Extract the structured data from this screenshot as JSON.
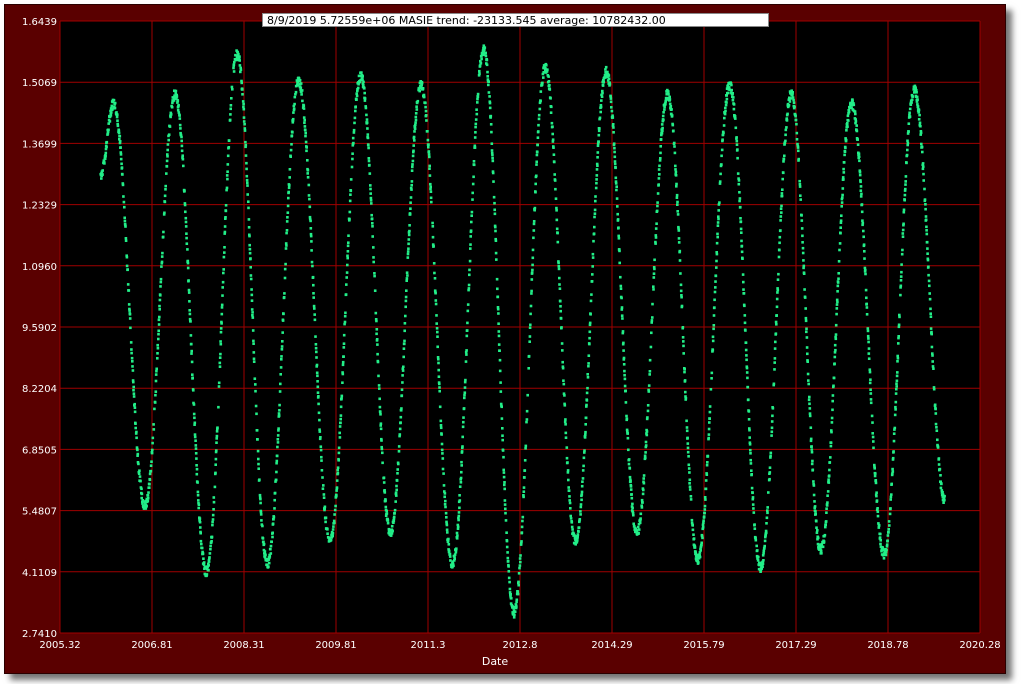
{
  "chart_data": {
    "type": "scatter",
    "title": "8/9/2019 5.72559e+06   MASIE trend: -23133.545 average: 10782432.00",
    "xlabel": "Date",
    "ylabel": "",
    "xlim": [
      2005.32,
      2020.28
    ],
    "ylim": [
      2.741,
      1.6439
    ],
    "x_ticks": [
      "2005.32",
      "2006.81",
      "2008.31",
      "2009.81",
      "2011.3",
      "2012.8",
      "2014.29",
      "2015.79",
      "2017.29",
      "2018.78",
      "2020.28"
    ],
    "y_ticks": [
      "1.6439",
      "1.5069",
      "1.3699",
      "1.2329",
      "1.0960",
      "9.5902",
      "8.2204",
      "6.8505",
      "5.4807",
      "4.1109",
      "2.7410"
    ],
    "y_values_millions": [
      16.439,
      15.069,
      13.699,
      12.329,
      10.96,
      9.5902,
      8.2204,
      6.8505,
      5.4807,
      4.1109,
      2.741
    ],
    "grid": true,
    "series_color": "#22ee88",
    "series_yearly": [
      {
        "max_x": 2006.19,
        "max_y": 14.6,
        "min_x": 2006.7,
        "min_y": 5.6
      },
      {
        "max_x": 2007.19,
        "max_y": 14.8,
        "min_x": 2007.7,
        "min_y": 4.1
      },
      {
        "max_x": 2008.2,
        "max_y": 15.7,
        "min_x": 2008.69,
        "min_y": 4.3
      },
      {
        "max_x": 2009.2,
        "max_y": 15.1,
        "min_x": 2009.71,
        "min_y": 4.8
      },
      {
        "max_x": 2010.21,
        "max_y": 15.2,
        "min_x": 2010.69,
        "min_y": 5.0
      },
      {
        "max_x": 2011.19,
        "max_y": 15.0,
        "min_x": 2011.7,
        "min_y": 4.3
      },
      {
        "max_x": 2012.21,
        "max_y": 15.8,
        "min_x": 2012.7,
        "min_y": 3.2
      },
      {
        "max_x": 2013.21,
        "max_y": 15.4,
        "min_x": 2013.7,
        "min_y": 4.8
      },
      {
        "max_x": 2014.2,
        "max_y": 15.3,
        "min_x": 2014.7,
        "min_y": 5.0
      },
      {
        "max_x": 2015.2,
        "max_y": 14.8,
        "min_x": 2015.69,
        "min_y": 4.4
      },
      {
        "max_x": 2016.21,
        "max_y": 15.0,
        "min_x": 2016.71,
        "min_y": 4.2
      },
      {
        "max_x": 2017.21,
        "max_y": 14.8,
        "min_x": 2017.69,
        "min_y": 4.6
      },
      {
        "max_x": 2018.19,
        "max_y": 14.6,
        "min_x": 2018.72,
        "min_y": 4.5
      },
      {
        "max_x": 2019.21,
        "max_y": 14.9,
        "min_x": 2019.71,
        "min_y": 5.7
      }
    ],
    "series_start": {
      "x": 2005.98,
      "y": 13.0
    },
    "series_end": {
      "x": 2019.61,
      "y": 5.73
    }
  }
}
